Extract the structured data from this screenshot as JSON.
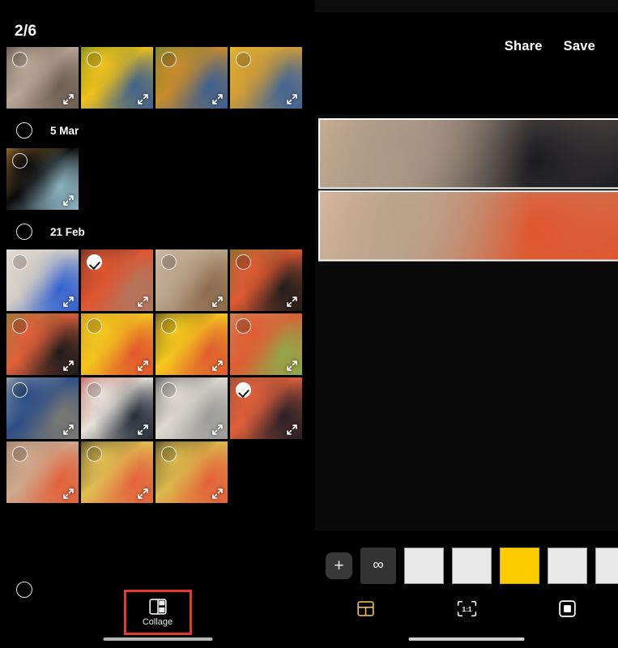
{
  "gallery": {
    "counter": "2/6",
    "sections": [
      {
        "date_label": "",
        "partial": true,
        "thumbs": [
          {
            "name": "hand-holding-phone-blur",
            "selected": false,
            "badge": false,
            "c1": "#b9a796",
            "c2": "#6d5e52",
            "c3": "#403830"
          },
          {
            "name": "yellow-blue-phone-on-bench",
            "selected": false,
            "badge": false,
            "c1": "#f0c21a",
            "c2": "#3b5f8f",
            "c3": "#4e7a2a"
          },
          {
            "name": "blue-phone-on-wooden-table",
            "selected": false,
            "badge": false,
            "c1": "#c98c2a",
            "c2": "#3a5e92",
            "c3": "#54802e"
          },
          {
            "name": "phone-on-wooden-slats",
            "selected": false,
            "badge": false,
            "c1": "#d09c36",
            "c2": "#3e639a",
            "c3": "#e8c427"
          }
        ]
      },
      {
        "date_label": "5 Mar",
        "partial": false,
        "thumbs": [
          {
            "name": "dark-abstract-light-streak",
            "selected": false,
            "badge": false,
            "c1": "#0b0b0c",
            "c2": "#8fb6c4",
            "c3": "#d99a3a"
          }
        ]
      },
      {
        "date_label": "21 Feb",
        "partial": false,
        "thumbs": [
          {
            "name": "phone-screen-blue-card",
            "selected": false,
            "badge": false,
            "c1": "#d4cdc4",
            "c2": "#2f5fd0",
            "c3": "#eae7e2"
          },
          {
            "name": "orange-realme-phone-in-hand",
            "selected": true,
            "badge": true,
            "c1": "#e0542f",
            "c2": "#b0785f",
            "c3": "#3a2a24"
          },
          {
            "name": "phone-edge-on-stone",
            "selected": false,
            "badge": false,
            "c1": "#bba48c",
            "c2": "#8a6a4c",
            "c3": "#d6c6b2"
          },
          {
            "name": "orange-phone-camera-module",
            "selected": false,
            "badge": false,
            "c1": "#e05a32",
            "c2": "#1c1c1c",
            "c3": "#5e7a32"
          },
          {
            "name": "orange-phone-camera-closeup",
            "selected": false,
            "badge": false,
            "c1": "#e1603a",
            "c2": "#1a1a1a",
            "c3": "#6a8a3a"
          },
          {
            "name": "orange-phone-yellow-box-bench",
            "selected": false,
            "badge": false,
            "c1": "#f3c61c",
            "c2": "#e0552d",
            "c3": "#c08c32"
          },
          {
            "name": "orange-phone-yellow-box-dark",
            "selected": false,
            "badge": false,
            "c1": "#f5c91c",
            "c2": "#df5a30",
            "c3": "#2a2a2a"
          },
          {
            "name": "orange-phone-held-in-hand",
            "selected": false,
            "badge": false,
            "c1": "#e05c33",
            "c2": "#8fa84a",
            "c3": "#c39a6a"
          },
          {
            "name": "phone-home-screen-blue-icons",
            "selected": false,
            "badge": false,
            "c1": "#2b4e86",
            "c2": "#7d7a72",
            "c3": "#c9c4bc"
          },
          {
            "name": "phone-on-patterned-cloth",
            "selected": false,
            "badge": false,
            "c1": "#e6e2da",
            "c2": "#232936",
            "c3": "#b4362f"
          },
          {
            "name": "grey-phone-on-patterned-cloth",
            "selected": false,
            "badge": false,
            "c1": "#dedad2",
            "c2": "#9a9a98",
            "c3": "#2a2a30"
          },
          {
            "name": "phone-dark-home-screen-in-hand",
            "selected": true,
            "badge": true,
            "c1": "#e0603a",
            "c2": "#251f28",
            "c3": "#7a4a3a"
          },
          {
            "name": "orange-phone-back-in-hand",
            "selected": false,
            "badge": false,
            "c1": "#cfa98c",
            "c2": "#e2603a",
            "c3": "#8a7260"
          },
          {
            "name": "orange-phone-on-bamboo",
            "selected": false,
            "badge": false,
            "c1": "#e0bf52",
            "c2": "#e4603c",
            "c3": "#1e1e1e"
          },
          {
            "name": "orange-phone-bamboo-angled",
            "selected": false,
            "badge": false,
            "c1": "#dcb94c",
            "c2": "#e3603a",
            "c3": "#202020"
          }
        ]
      }
    ],
    "collage_button": {
      "label": "Collage",
      "icon": "collage-grid-icon",
      "highlight_color": "#e03b2c"
    }
  },
  "editor": {
    "header": {
      "share_label": "Share",
      "save_label": "Save"
    },
    "collage_photos": [
      {
        "name": "hand-holding-phone-app-drawer",
        "c1": "#a89684",
        "c2": "#1b1b20",
        "c3": "#d8b89a"
      },
      {
        "name": "orange-realme-phone-back-in-hand",
        "c1": "#b9a18a",
        "c2": "#e0552d",
        "c3": "#e8c3a8"
      }
    ],
    "toolbar": {
      "add_label": "+",
      "freeform_label": "∞",
      "layouts": [
        {
          "name": "layout-l-shape",
          "selected": false,
          "pattern": "l-shape"
        },
        {
          "name": "layout-two-columns",
          "selected": false,
          "pattern": "two-col"
        },
        {
          "name": "layout-two-rows",
          "selected": true,
          "pattern": "two-row"
        },
        {
          "name": "layout-two-columns-wide",
          "selected": false,
          "pattern": "two-col"
        },
        {
          "name": "layout-top-strip",
          "selected": false,
          "pattern": "top-strip"
        }
      ]
    },
    "tabs": [
      {
        "name": "tab-layout",
        "icon": "collage-grid-icon",
        "label": "",
        "active": true
      },
      {
        "name": "tab-ratio",
        "icon": "ratio-1-1-icon",
        "label": "1:1",
        "active": false
      },
      {
        "name": "tab-border",
        "icon": "border-frame-icon",
        "label": "",
        "active": false
      }
    ],
    "accent_color": "#e8c04a"
  }
}
